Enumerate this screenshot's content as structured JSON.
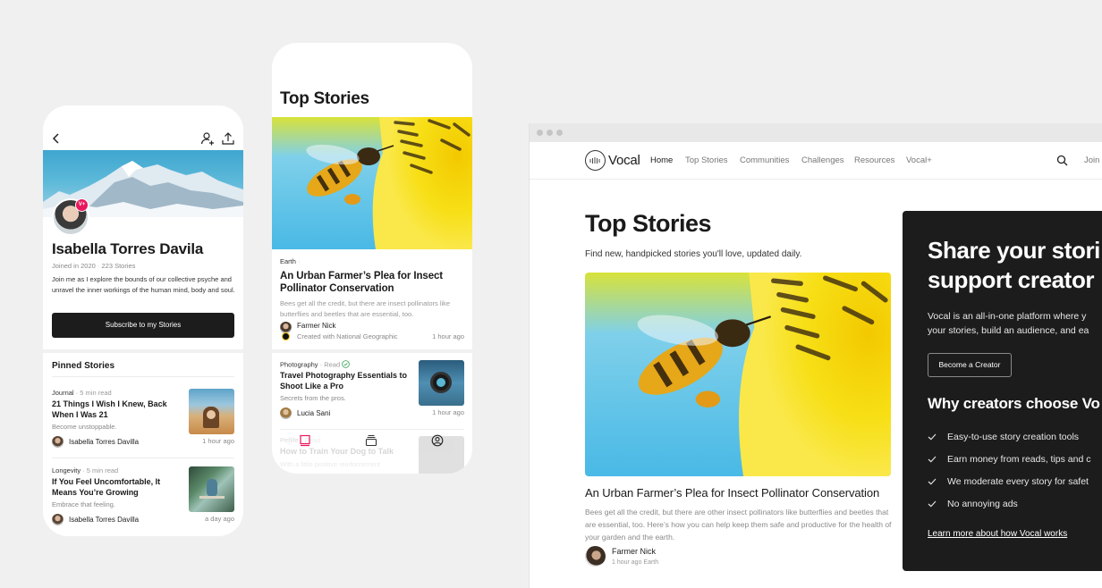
{
  "profile_phone": {
    "name": "Isabella Torres Davila",
    "badge": "V+",
    "joined": "Joined in 2020",
    "stories_count": "223 Stories",
    "bio": "Join me as I explore the bounds of our collective psyche and unravel the inner workings of the human mind, body and soul.",
    "subscribe_label": "Subscribe to my Stories",
    "pinned_heading": "Pinned Stories",
    "stories": [
      {
        "category": "Journal",
        "read_time": "5 min read",
        "title": "21 Things I Wish I Knew, Back When I Was 21",
        "subtitle": "Become unstoppable.",
        "author": "Isabella Torres Davilla",
        "time": "1 hour ago"
      },
      {
        "category": "Longevity",
        "read_time": "5 min read",
        "title": "If You Feel Uncomfortable, It Means You’re Growing",
        "subtitle": "Embrace that feeling.",
        "author": "Isabella Torres Davilla",
        "time": "a day ago"
      }
    ]
  },
  "feed_phone": {
    "title": "Top Stories",
    "featured": {
      "category": "Earth",
      "title": "An Urban Farmer’s Plea for Insect Pollinator Conservation",
      "excerpt": "Bees get all the credit, but there are insect pollinators like butterflies and beetles that are essential, too.",
      "author": "Farmer Nick",
      "credit": "Created with National Geographic",
      "time": "1 hour ago"
    },
    "stories": [
      {
        "category": "Photography",
        "status": "Read",
        "title": "Travel Photography Essentials to Shoot Like a Pro",
        "subtitle": "Secrets from the pros.",
        "author": "Lucia Sani",
        "time": "1 hour ago"
      },
      {
        "category": "Petlife",
        "status": "Read",
        "title": "How to Train Your Dog to Talk",
        "subtitle": "With a little positive reinforcement"
      }
    ],
    "tabbar": [
      "feed-icon",
      "collections-icon",
      "profile-icon"
    ],
    "accent_color": "#e8185c"
  },
  "browser": {
    "brand": "Vocal",
    "nav": [
      {
        "label": "Home",
        "active": true
      },
      {
        "label": "Top Stories",
        "active": false
      },
      {
        "label": "Communities",
        "active": false
      },
      {
        "label": "Challenges",
        "active": false
      },
      {
        "label": "Resources",
        "active": false
      },
      {
        "label": "Vocal+",
        "active": false
      }
    ],
    "join_label": "Join",
    "page_title": "Top Stories",
    "page_subtitle": "Find new, handpicked stories you'll love, updated daily.",
    "featured": {
      "title": "An Urban Farmer’s Plea for Insect Pollinator Conservation",
      "excerpt": "Bees get all the credit, but there are other insect pollinators like butterflies and beetles that are essential, too. Here’s how you can help keep them safe and productive for the health of your garden and the earth.",
      "author": "Farmer Nick",
      "meta": "1 hour ago Earth"
    },
    "promo": {
      "heading_line1": "Share your stori",
      "heading_line2": "support creator",
      "body_line1": "Vocal is an all-in-one platform where y",
      "body_line2": "your stories, build an audience, and ea",
      "cta": "Become a Creator",
      "why_heading": "Why creators choose Vo",
      "features": [
        "Easy-to-use story creation tools",
        "Earn money from reads, tips and c",
        "We moderate every story for safet",
        "No annoying ads"
      ],
      "learn_more": "Learn more about how Vocal works"
    }
  }
}
